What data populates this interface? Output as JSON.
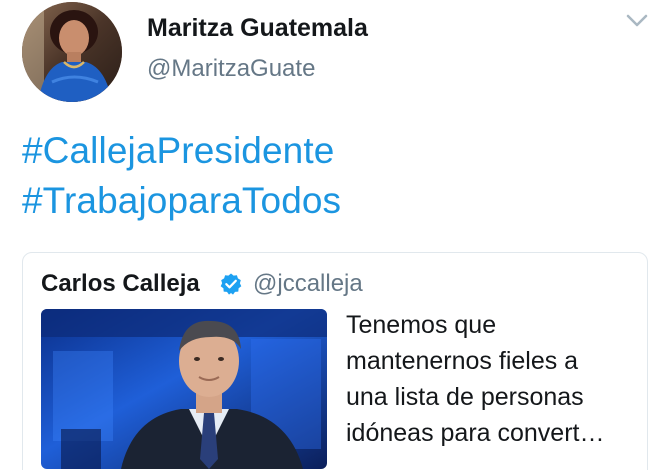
{
  "tweet": {
    "author_name": "Maritza Guatemala",
    "author_handle": "@MaritzaGuate",
    "hashtags": [
      "#CallejaPresidente",
      "#TrabajoparaTodos"
    ]
  },
  "quoted_tweet": {
    "author_name": "Carlos Calleja",
    "author_handle": "@jccalleja",
    "verified": true,
    "text_lines": [
      "Tenemos que",
      "mantenernos fieles a",
      "una lista de personas",
      "idóneas para convert…"
    ]
  },
  "icons": {
    "menu": "chevron-down-icon",
    "verified": "verified-badge-icon"
  },
  "colors": {
    "link": "#1b95e0",
    "name": "#14171a",
    "handle": "#657786",
    "verified": "#1da1f2",
    "card_border": "#e1e8ed"
  }
}
